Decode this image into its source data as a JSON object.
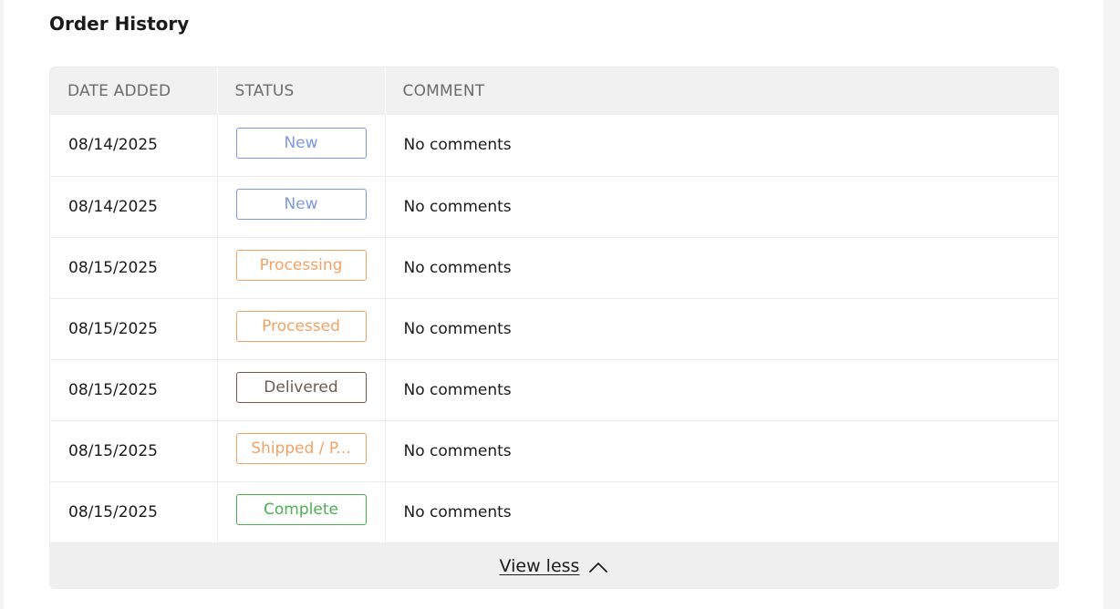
{
  "section_title": "Order History",
  "table": {
    "columns": [
      "DATE ADDED",
      "STATUS",
      "COMMENT"
    ],
    "rows": [
      {
        "date": "08/14/2025",
        "status": "New",
        "status_color": "#7d98e6",
        "comment": "No comments"
      },
      {
        "date": "08/14/2025",
        "status": "New",
        "status_color": "#7d98e6",
        "comment": "No comments"
      },
      {
        "date": "08/15/2025",
        "status": "Processing",
        "status_color": "#f2a265",
        "comment": "No comments"
      },
      {
        "date": "08/15/2025",
        "status": "Processed",
        "status_color": "#f2a265",
        "comment": "No comments"
      },
      {
        "date": "08/15/2025",
        "status": "Delivered",
        "status_color": "#6e5a4f",
        "comment": "No comments"
      },
      {
        "date": "08/15/2025",
        "status": "Shipped / P...",
        "status_color": "#f2a265",
        "comment": "No comments"
      },
      {
        "date": "08/15/2025",
        "status": "Complete",
        "status_color": "#4caf50",
        "comment": "No comments"
      }
    ]
  },
  "footer": {
    "toggle_label": "View less",
    "toggle_icon": "chevron-up-icon"
  }
}
